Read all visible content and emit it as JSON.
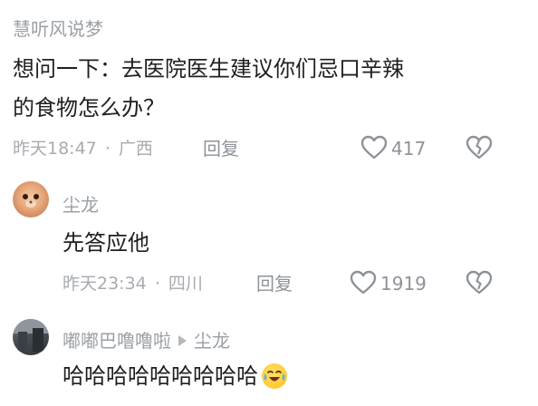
{
  "comments": [
    {
      "username": "慧听风说梦",
      "text_lines": [
        "想问一下：去医院医生建议你们忌口辛辣",
        "的食物怎么办？"
      ],
      "time": "昨天18:47",
      "location": "广西",
      "reply_label": "回复",
      "likes": "417",
      "avatar_icon": "none"
    },
    {
      "username": "尘龙",
      "text": "先答应他",
      "time": "昨天23:34",
      "location": "四川",
      "reply_label": "回复",
      "likes": "1919",
      "avatar_icon": "hamster-avatar"
    },
    {
      "username": "嘟嘟巴噜噜啦",
      "reply_to": "尘龙",
      "text": "哈哈哈哈哈哈哈哈哈",
      "avatar_icon": "photo-avatar",
      "emoji": "crying-laughing-emoji"
    }
  ],
  "separator": "·",
  "icons": {
    "like": "heart-outline-icon",
    "dislike": "broken-heart-icon",
    "reply_arrow": "play-triangle-icon"
  },
  "colors": {
    "username": "#9aa0a6",
    "body": "#1f1f1f",
    "meta": "#a7abb0",
    "icon": "#8e9399"
  }
}
